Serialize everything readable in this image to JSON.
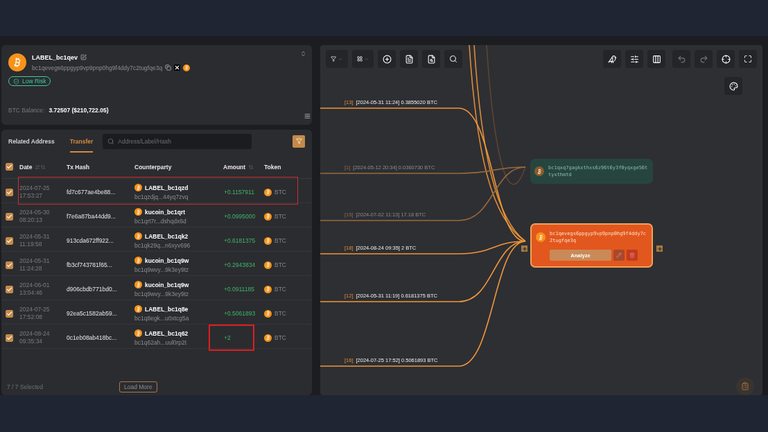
{
  "profile": {
    "label": "LABEL_bc1qev",
    "address": "bc1qevegs6ppgyp9vp9pnp0hg9f4ddy7c2tugfqe3q",
    "risk": "Low Risk",
    "balance_label": "BTC Balance:",
    "balance_value": "3.72507 ($210,722.05)"
  },
  "tabs": [
    {
      "label": "Related Address",
      "selected": false
    },
    {
      "label": "Transfer",
      "selected": true
    }
  ],
  "search": {
    "placeholder": "Address/Label/Hash"
  },
  "table": {
    "all_checked": true,
    "columns": [
      "Date",
      "Tx Hash",
      "Counterparty",
      "Amount",
      "Token"
    ],
    "rows": [
      {
        "checked": true,
        "date": "2024-07-25 17:53:27",
        "hash": "fd7c677ae4be88...",
        "counterparty": "LABEL_bc1qzd",
        "address": "bc1qzdjq...44yq7zvq",
        "amount": "+0.1157911",
        "token": "BTC",
        "row_highlighted": true,
        "amount_highlighted": false
      },
      {
        "checked": true,
        "date": "2024-05-30 08:20:13",
        "hash": "f7e6a87ba44dd9...",
        "counterparty": "kucoin_bc1qrt",
        "address": "bc1qrt7r...dshqdx6d",
        "amount": "+0.0995000",
        "token": "BTC",
        "row_highlighted": false,
        "amount_highlighted": false
      },
      {
        "checked": true,
        "date": "2024-05-31 11:19:58",
        "hash": "913cda672ff922...",
        "counterparty": "LABEL_bc1qk2",
        "address": "bc1qk29q...n6xyv696",
        "amount": "+0.6181375",
        "token": "BTC",
        "row_highlighted": false,
        "amount_highlighted": false
      },
      {
        "checked": true,
        "date": "2024-05-31 11:24:28",
        "hash": "fb3cf743781f65...",
        "counterparty": "kucoin_bc1q9w",
        "address": "bc1q9wvy...9k3ey9tz",
        "amount": "+0.2943834",
        "token": "BTC",
        "row_highlighted": false,
        "amount_highlighted": false
      },
      {
        "checked": true,
        "date": "2024-06-01 13:04:46",
        "hash": "d906cbdb771bd0...",
        "counterparty": "kucoin_bc1q9w",
        "address": "bc1q9wvy...9k3ey9tz",
        "amount": "+0.0911185",
        "token": "BTC",
        "row_highlighted": false,
        "amount_highlighted": false
      },
      {
        "checked": true,
        "date": "2024-07-25 17:52:08",
        "hash": "92ea5c1582ab59...",
        "counterparty": "LABEL_bc1q8e",
        "address": "bc1q8egk...u0xtcg5a",
        "amount": "+0.5061893",
        "token": "BTC",
        "row_highlighted": false,
        "amount_highlighted": false
      },
      {
        "checked": true,
        "date": "2024-08-24 09:35:34",
        "hash": "0c1eb08ab418bc...",
        "counterparty": "LABEL_bc1q62",
        "address": "bc1q62ah...uul0rp2t",
        "amount": "+2",
        "token": "BTC",
        "row_highlighted": false,
        "amount_highlighted": true
      }
    ]
  },
  "footer": {
    "selection": "7 / 7 Selected",
    "load_more": "Load More"
  },
  "graph": {
    "edges": [
      {
        "index": "[13]",
        "label": "[2024-05-31 11:24] 0.3855020 BTC",
        "dim": false
      },
      {
        "index": "[1]",
        "label": "[2024-05-12 20:34] 0.0360730 BTC",
        "dim": true
      },
      {
        "index": "[15]",
        "label": "[2024-07-02 11:13] 17.18 BTC",
        "dim": true
      },
      {
        "index": "[18]",
        "label": "[2024-08-24 09:35] 2 BTC",
        "dim": false
      },
      {
        "index": "[12]",
        "label": "[2024-05-31 11:19] 0.6181375 BTC",
        "dim": false
      },
      {
        "index": "[16]",
        "label": "[2024-07-25 17:52] 0.5061893 BTC",
        "dim": false
      }
    ],
    "nodes": [
      {
        "address": "bc1qxq7gagkxthxs6z96t6y3f0yqxge56ttyxthmtd",
        "selected": false
      },
      {
        "address": "bc1qevegs6ppgyp9vp9pnp0hg9f4ddy7c2tugfqe3q",
        "selected": true,
        "action": "Analyze"
      }
    ]
  }
}
